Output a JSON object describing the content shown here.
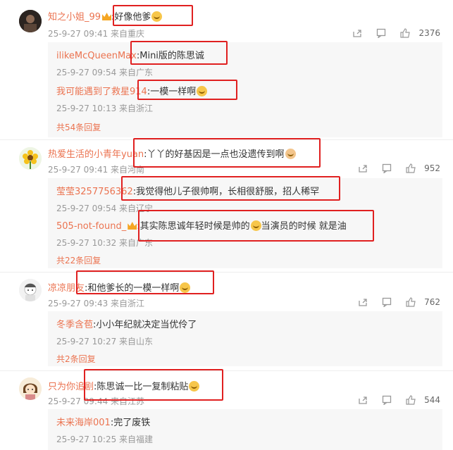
{
  "comments": [
    {
      "user": "知之小姐_99",
      "text": ":好像他爹",
      "time": "25-9-27 09:41 来自重庆",
      "likes": "2376",
      "replies": [
        {
          "user": "ilikeMcQueenMax",
          "text": ":Mini版的陈思诚",
          "time": "25-9-27 09:54 来自广东"
        },
        {
          "user": "我可能遇到了救星914",
          "text": ":一模一样啊",
          "time": "25-9-27 10:13 来自浙江"
        }
      ],
      "more": "共54条回复"
    },
    {
      "user": "热爱生活的小青年yuan",
      "text": ":丫丫的好基因是一点也没遗传到啊",
      "time": "25-9-27 09:41 来自河南",
      "likes": "952",
      "replies": [
        {
          "user": "莹莹3257756362",
          "text": ":我觉得他儿子很帅啊，长相很舒服，招人稀罕",
          "time": "25-9-27 09:54 来自辽宁"
        },
        {
          "user": "505-not-found_",
          "text": ":其实陈思诚年轻时候是帅的",
          "text2": "当演员的时候 就是油",
          "time": "25-9-27 10:32 来自广东"
        }
      ],
      "more": "共22条回复"
    },
    {
      "user": "凉凉朋友",
      "text": ":和他爹长的一模一样啊",
      "time": "25-9-27 09:43 来自浙江",
      "likes": "762",
      "replies": [
        {
          "user": "冬季含苞",
          "text": ":小小年纪就决定当优伶了",
          "time": "25-9-27 10:27 来自山东"
        }
      ],
      "more": "共2条回复"
    },
    {
      "user": "只为你追剧",
      "text": ":陈思诚一比一复制粘贴",
      "time": "25-9-27 09:44 来自江苏",
      "likes": "544",
      "replies": [
        {
          "user": "未来海岸001",
          "text": ":完了废铁",
          "time": "25-9-27 10:25 来自福建"
        }
      ],
      "more": ""
    }
  ],
  "icons": {
    "share": "share-icon",
    "reply": "comment-icon",
    "like": "thumbs-up-icon",
    "emoji": "laughing-emoji-icon"
  },
  "colors": {
    "username": "#eb7350",
    "annotation_box": "#e02020",
    "reply_bg": "#f7f7f7"
  }
}
